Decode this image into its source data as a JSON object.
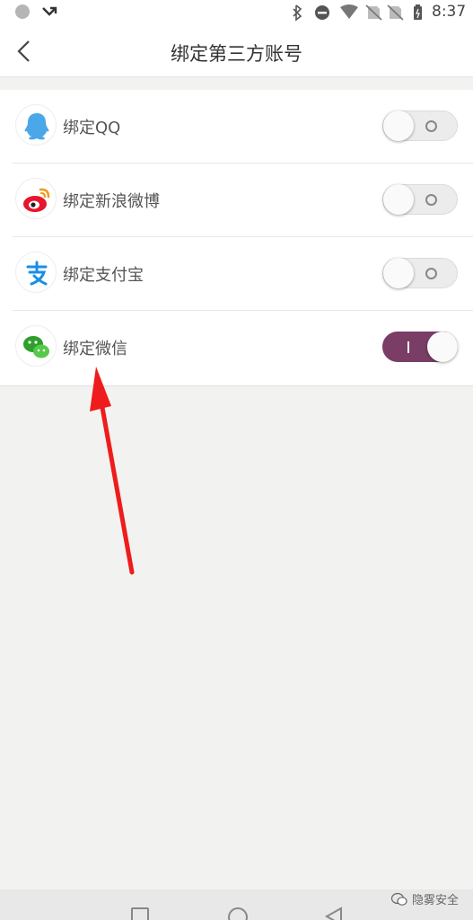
{
  "status_bar": {
    "time": "8:37",
    "left_icons": [
      "notification-dot-icon",
      "missed-call-arrow-icon"
    ],
    "right_icons": [
      "bluetooth-icon",
      "do-not-disturb-icon",
      "wifi-icon",
      "no-sim-icon",
      "no-sim-icon",
      "battery-icon"
    ]
  },
  "header": {
    "title": "绑定第三方账号",
    "back_icon": "chevron-left-icon"
  },
  "accounts": [
    {
      "label": "绑定QQ",
      "icon": "qq-icon",
      "enabled": false
    },
    {
      "label": "绑定新浪微博",
      "icon": "weibo-icon",
      "enabled": false
    },
    {
      "label": "绑定支付宝",
      "icon": "alipay-icon",
      "enabled": false
    },
    {
      "label": "绑定微信",
      "icon": "wechat-icon",
      "enabled": true
    }
  ],
  "colors": {
    "toggle_on": "#7a3d66",
    "annotation_arrow": "#ee1c1c",
    "qq": "#4aa8e8",
    "weibo": "#e6162d",
    "alipay": "#1a8ee6",
    "wechat": "#3bb838"
  },
  "watermark": {
    "text": "隐雾安全",
    "icon": "wechat-icon"
  },
  "nav_bar": {
    "buttons": [
      "recent-apps-icon",
      "home-icon",
      "back-icon"
    ]
  }
}
